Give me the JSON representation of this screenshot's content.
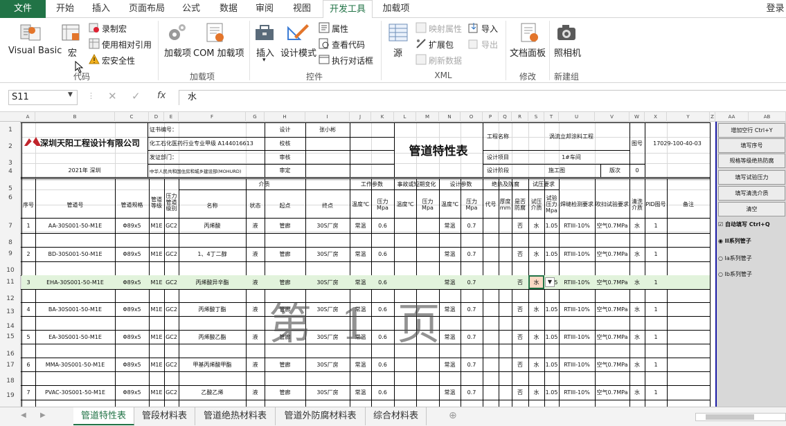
{
  "tabs": [
    "文件",
    "开始",
    "插入",
    "页面布局",
    "公式",
    "数据",
    "审阅",
    "视图",
    "开发工具",
    "加载项"
  ],
  "login": "登录",
  "ribbon": {
    "code": {
      "vb": "Visual Basic",
      "macro": "宏",
      "record": "录制宏",
      "relative": "使用相对引用",
      "security": "宏安全性",
      "label": "代码"
    },
    "addins": {
      "addin": "加载项",
      "com": "COM 加载项",
      "label": "加载项"
    },
    "controls": {
      "insert": "插入",
      "design": "设计模式",
      "props": "属性",
      "viewcode": "查看代码",
      "dialog": "执行对话框",
      "label": "控件"
    },
    "xml": {
      "source": "源",
      "mapprops": "映射属性",
      "expand": "扩展包",
      "refresh": "刷新数据",
      "import": "导入",
      "export": "导出",
      "label": "XML"
    },
    "modify": {
      "docpanel": "文档面板",
      "label": "修改"
    },
    "newgroup": {
      "camera": "照相机",
      "label": "新建组"
    }
  },
  "formula": {
    "namebox": "S11",
    "value": "水",
    "fx": "fx"
  },
  "columns": [
    "A",
    "B",
    "C",
    "D",
    "E",
    "F",
    "G",
    "H",
    "I",
    "J",
    "K",
    "L",
    "M",
    "N",
    "O",
    "P",
    "Q",
    "R",
    "S",
    "T",
    "U",
    "V",
    "W",
    "X",
    "Y",
    "Z",
    "AA",
    "AB"
  ],
  "rows": [
    "1",
    "2",
    "3",
    "4",
    "5",
    "6",
    "7",
    "8",
    "9",
    "10",
    "11",
    "12",
    "13",
    "14",
    "15",
    "16",
    "17",
    "18",
    "19"
  ],
  "header": {
    "company": "深圳天阳工程设计有限公司",
    "year": "2021年 深圳",
    "cert_no": "证书编号：",
    "cert_desc": "化工石化医药行业专业甲级 A144016613",
    "issuer": "发证部门：",
    "issuer_desc": "中华人民共和国住房和城乡建设部(MOHURD)",
    "design": "设计",
    "designer": "张小彬",
    "check": "校核",
    "review": "审核",
    "approve": "审定",
    "title": "管道特性表",
    "project_name_lbl": "工程名称",
    "project_name": "涡流立邦涂料工程",
    "design_item_lbl": "设计项目",
    "design_item": "1#车间",
    "stage_lbl": "设计阶段",
    "stage": "施工图",
    "version_lbl": "版次",
    "version": "0",
    "drawing_lbl": "图号",
    "drawing": "17029-100-40-03"
  },
  "colheads": {
    "no": "序号",
    "pipe": "管道号",
    "spec": "管道规格",
    "grade": "管道等级",
    "pclass": "压力管道级别",
    "medium": "介质",
    "name": "名称",
    "state": "状态",
    "start": "起点",
    "end": "终点",
    "work": "工作参数",
    "temp": "温度℃",
    "press": "压力Mpa",
    "accident": "事故或短期变化",
    "design": "设计参数",
    "insul": "绝热及防腐",
    "code": "代号",
    "thick": "厚度mm",
    "anti": "是否防腐",
    "test": "试压要求",
    "tmed": "试压介质",
    "tpress": "试验压力Mpa",
    "nde": "焊缝检测要求",
    "clean": "吹扫试验要求",
    "cmed": "清洗介质",
    "pid": "PID图号",
    "remark": "备注"
  },
  "data_rows": [
    {
      "no": "1",
      "pipe": "AA-30S001-50-M1E",
      "spec": "Φ89x5",
      "grade": "M1E",
      "pclass": "GC2",
      "name": "丙烯酸",
      "state": "液",
      "start": "管廊",
      "end": "30S厂房",
      "wt": "常温",
      "wp": "0.6",
      "dt": "常温",
      "dp": "0.7",
      "anti": "否",
      "tm": "水",
      "tp": "1.05",
      "nde": "RTIII-10%",
      "clean": "空气0.7MPa",
      "cm": "水",
      "pid": "1"
    },
    {
      "no": "2",
      "pipe": "BD-30S001-50-M1E",
      "spec": "Φ89x5",
      "grade": "M1E",
      "pclass": "GC2",
      "name": "1、4丁二醇",
      "state": "液",
      "start": "管廊",
      "end": "30S厂房",
      "wt": "常温",
      "wp": "0.6",
      "dt": "常温",
      "dp": "0.7",
      "anti": "否",
      "tm": "水",
      "tp": "1.05",
      "nde": "RTIII-10%",
      "clean": "空气0.7MPa",
      "cm": "水",
      "pid": "1"
    },
    {
      "no": "3",
      "pipe": "EHA-30S001-50-M1E",
      "spec": "Φ89x5",
      "grade": "M1E",
      "pclass": "GC2",
      "name": "丙烯酸异辛酯",
      "state": "液",
      "start": "管廊",
      "end": "30S厂房",
      "wt": "常温",
      "wp": "0.6",
      "dt": "常温",
      "dp": "0.7",
      "anti": "否",
      "tm": "水",
      "tp": "1.05",
      "nde": "RTIII-10%",
      "clean": "空气0.7MPa",
      "cm": "水",
      "pid": "1"
    },
    {
      "no": "4",
      "pipe": "BA-30S001-50-M1E",
      "spec": "Φ89x5",
      "grade": "M1E",
      "pclass": "GC2",
      "name": "丙烯酸丁酯",
      "state": "液",
      "start": "管廊",
      "end": "30S厂房",
      "wt": "常温",
      "wp": "0.6",
      "dt": "常温",
      "dp": "0.7",
      "anti": "否",
      "tm": "水",
      "tp": "1.05",
      "nde": "RTIII-10%",
      "clean": "空气0.7MPa",
      "cm": "水",
      "pid": "1"
    },
    {
      "no": "5",
      "pipe": "EA-30S001-50-M1E",
      "spec": "Φ89x5",
      "grade": "M1E",
      "pclass": "GC2",
      "name": "丙烯酸乙酯",
      "state": "液",
      "start": "管廊",
      "end": "30S厂房",
      "wt": "常温",
      "wp": "0.6",
      "dt": "常温",
      "dp": "0.7",
      "anti": "否",
      "tm": "水",
      "tp": "1.05",
      "nde": "RTIII-10%",
      "clean": "空气0.7MPa",
      "cm": "水",
      "pid": "1"
    },
    {
      "no": "6",
      "pipe": "MMA-30S001-50-M1E",
      "spec": "Φ89x5",
      "grade": "M1E",
      "pclass": "GC2",
      "name": "甲基丙烯酸甲酯",
      "state": "液",
      "start": "管廊",
      "end": "30S厂房",
      "wt": "常温",
      "wp": "0.6",
      "dt": "常温",
      "dp": "0.7",
      "anti": "否",
      "tm": "水",
      "tp": "1.05",
      "nde": "RTIII-10%",
      "clean": "空气0.7MPa",
      "cm": "水",
      "pid": "1"
    },
    {
      "no": "7",
      "pipe": "PVAC-30S001-50-M1E",
      "spec": "Φ89x5",
      "grade": "M1E",
      "pclass": "GC2",
      "name": "乙酸乙烯",
      "state": "液",
      "start": "管廊",
      "end": "30S厂房",
      "wt": "常温",
      "wp": "0.6",
      "dt": "常温",
      "dp": "0.7",
      "anti": "否",
      "tm": "水",
      "tp": "1.05",
      "nde": "RTIII-10%",
      "clean": "空气0.7MPa",
      "cm": "水",
      "pid": "1"
    }
  ],
  "watermark": "第1页",
  "panel": {
    "buttons": [
      "增加空行 Ctrl+Y",
      "填写序号",
      "规格等级绝热防腐",
      "填写试验压力",
      "填写清洗介质",
      "清空"
    ],
    "auto": "自动填写 Ctrl+Q",
    "series": [
      "II系列管子",
      "Ia系列管子",
      "Ib系列管子"
    ]
  },
  "sheets": [
    "管道特性表",
    "管段材料表",
    "管道绝热材料表",
    "管道外防腐材料表",
    "综合材料表"
  ]
}
